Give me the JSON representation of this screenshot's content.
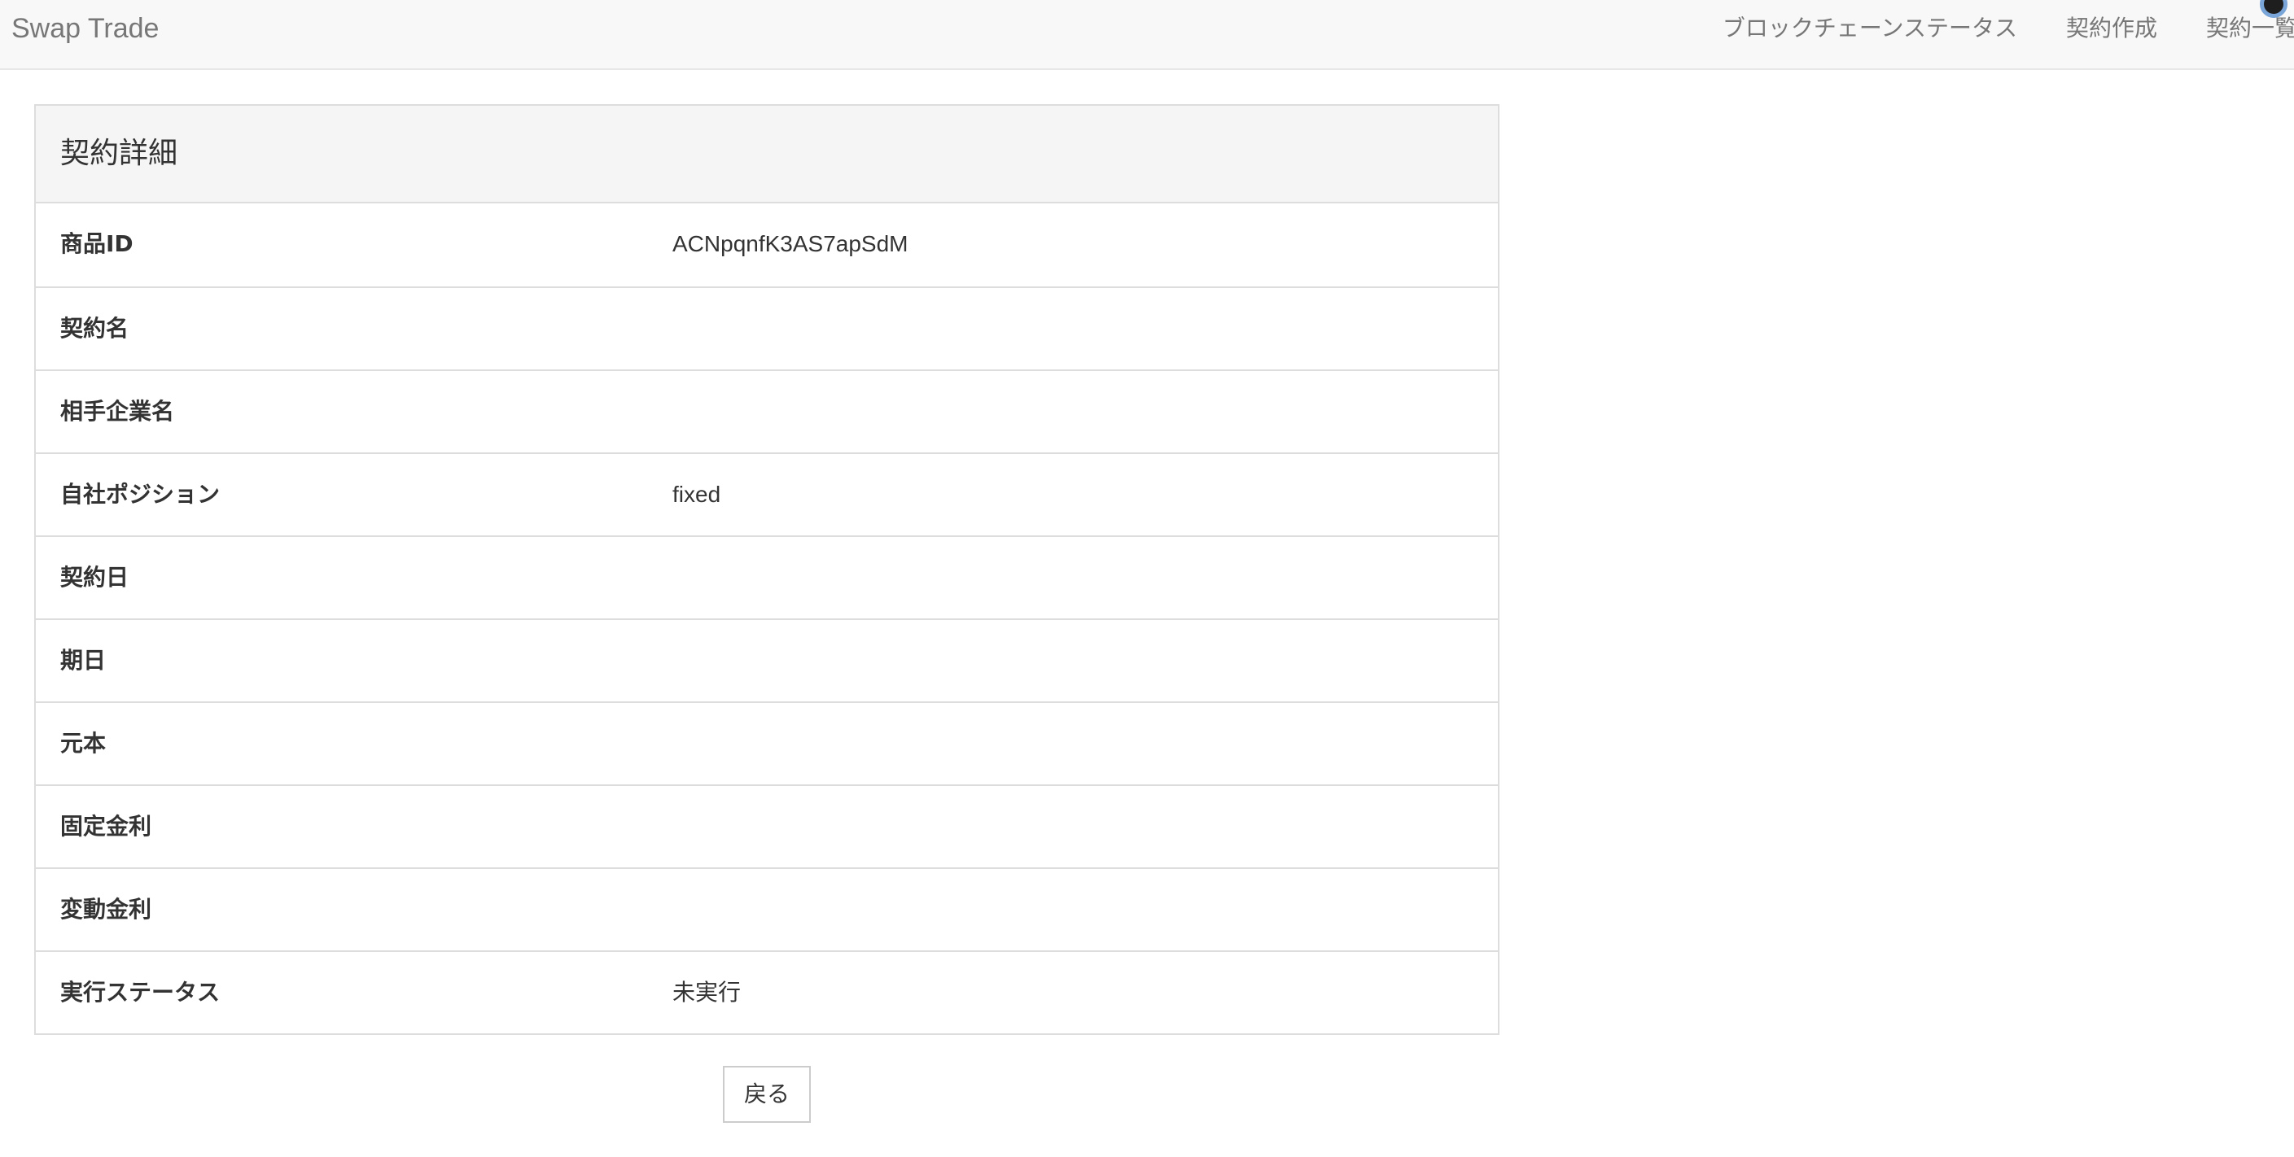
{
  "navbar": {
    "brand": "Swap Trade",
    "links": [
      {
        "label": "ブロックチェーンステータス"
      },
      {
        "label": "契約作成"
      },
      {
        "label": "契約一覧"
      }
    ]
  },
  "panel": {
    "title": "契約詳細",
    "rows": [
      {
        "label": "商品ID",
        "value": "ACNpqnfK3AS7apSdM"
      },
      {
        "label": "契約名",
        "value": ""
      },
      {
        "label": "相手企業名",
        "value": ""
      },
      {
        "label": "自社ポジション",
        "value": "fixed"
      },
      {
        "label": "契約日",
        "value": ""
      },
      {
        "label": "期日",
        "value": ""
      },
      {
        "label": "元本",
        "value": ""
      },
      {
        "label": "固定金利",
        "value": ""
      },
      {
        "label": "変動金利",
        "value": ""
      },
      {
        "label": "実行ステータス",
        "value": "未実行"
      }
    ]
  },
  "actions": {
    "back_label": "戻る"
  }
}
